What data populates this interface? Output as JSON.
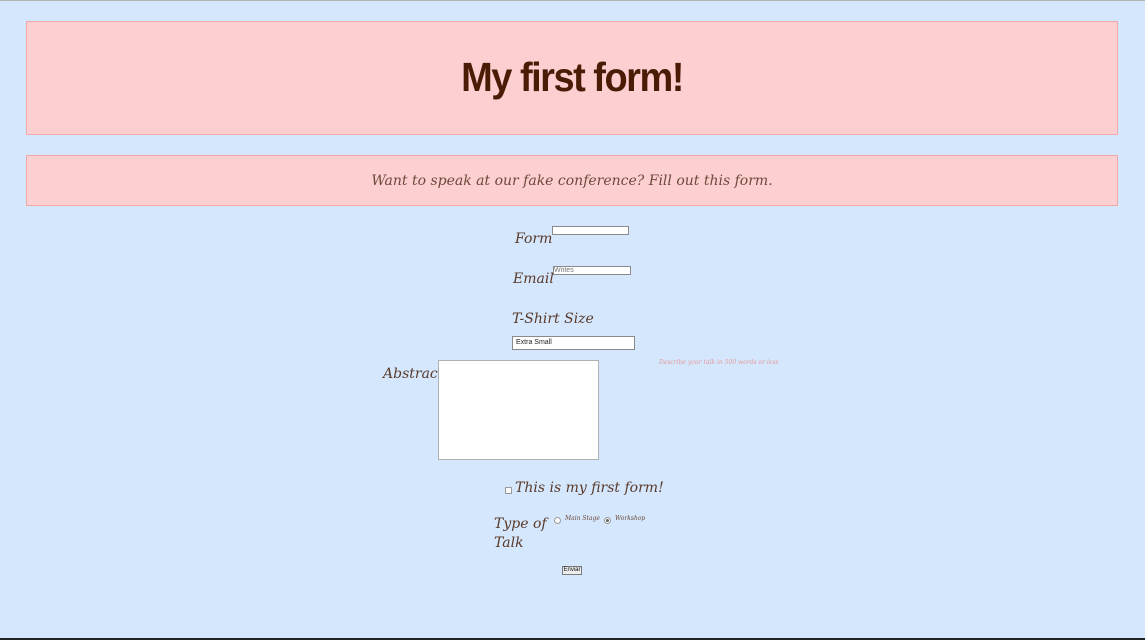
{
  "header": {
    "title": "My first form!"
  },
  "intro": {
    "text": "Want to speak at our fake conference? Fill out this form."
  },
  "form": {
    "name_label": "Form",
    "name_value": "",
    "email_label": "Email",
    "email_placeholder": "Writes",
    "tshirt_label": "T-Shirt Size",
    "tshirt_selected": "Extra Small",
    "abstract_label": "Abstract",
    "abstract_hint": "Describe your talk in 500 words or less",
    "checkbox_label": "This is my first form!",
    "talk_type_label_line1": "Type of",
    "talk_type_label_line2": "Talk",
    "talk_types": [
      {
        "label": "Main Stage",
        "checked": false
      },
      {
        "label": "Workshop",
        "checked": true
      }
    ],
    "submit_label": "Enviar"
  },
  "colors": {
    "page_background": "#d4e7fd",
    "panel_background": "#fecfd1",
    "title_color": "#4a1c06",
    "hint_color": "#e59a9a"
  }
}
